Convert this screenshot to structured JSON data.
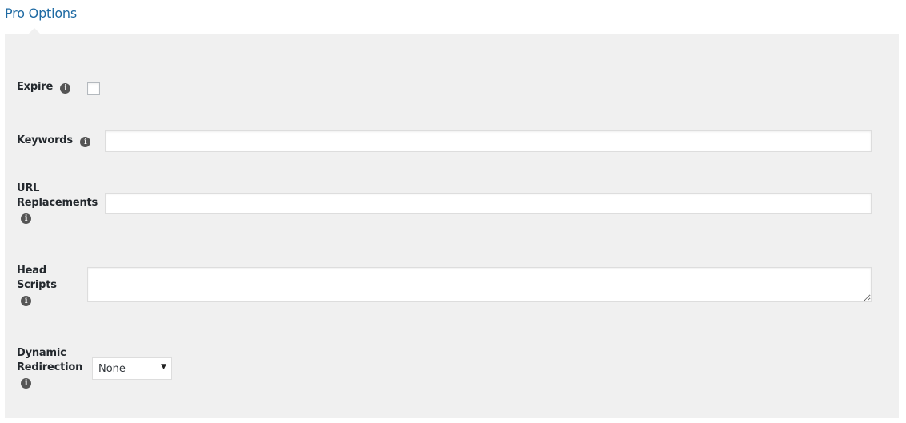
{
  "section": {
    "title": "Pro Options"
  },
  "fields": {
    "expire": {
      "label": "Expire",
      "info_icon": "i",
      "checked": false
    },
    "keywords": {
      "label": "Keywords",
      "info_icon": "i",
      "value": "",
      "placeholder": ""
    },
    "url_replacements": {
      "label_line1": "URL",
      "label_line2": "Replacements",
      "info_icon": "i",
      "value": "",
      "placeholder": ""
    },
    "head_scripts": {
      "label_line1": "Head",
      "label_line2": "Scripts",
      "info_icon": "i",
      "value": ""
    },
    "dynamic_redirection": {
      "label_line1": "Dynamic",
      "label_line2": "Redirection",
      "info_icon": "i",
      "selected": "None",
      "arrow": "▼"
    }
  },
  "colors": {
    "title": "#1e6aa3",
    "panel_bg": "#f0f0f0",
    "info_icon_bg": "#555555"
  }
}
